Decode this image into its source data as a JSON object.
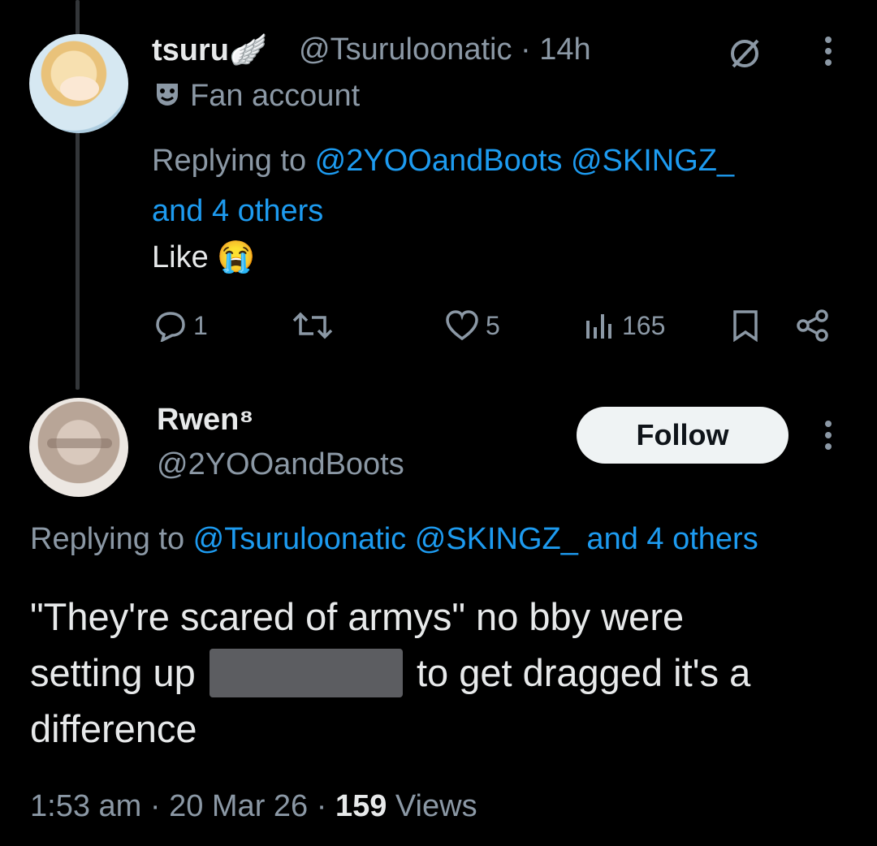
{
  "tweet1": {
    "display_name": "tsuru",
    "name_emoji": "🪽",
    "handle": "@Tsuruloonatic",
    "time": "· 14h",
    "label_icon": "theater-masks-icon",
    "label": "Fan account",
    "replying_prefix": "Replying to ",
    "replying_handles": "@2YOOandBoots @SKINGZ_",
    "replying_others": "and 4 others",
    "text": "Like",
    "emoji": "😭",
    "replies": "1",
    "likes": "5",
    "views": "165"
  },
  "tweet2": {
    "display_name": "Rwen⁸",
    "handle": "@2YOOandBoots",
    "follow_label": "Follow",
    "replying_prefix": "Replying to ",
    "replying_handles": "@Tsuruloonatic @SKINGZ_ and 4 others",
    "text_line1": "\"They're scared of armys\" no bby were",
    "text_line2a": "setting up",
    "text_line2b": "to get dragged it's a",
    "text_line3": "difference",
    "time": "1:53 am · 20 Mar 26 · ",
    "views_count": "159",
    "views_label": " Views"
  }
}
